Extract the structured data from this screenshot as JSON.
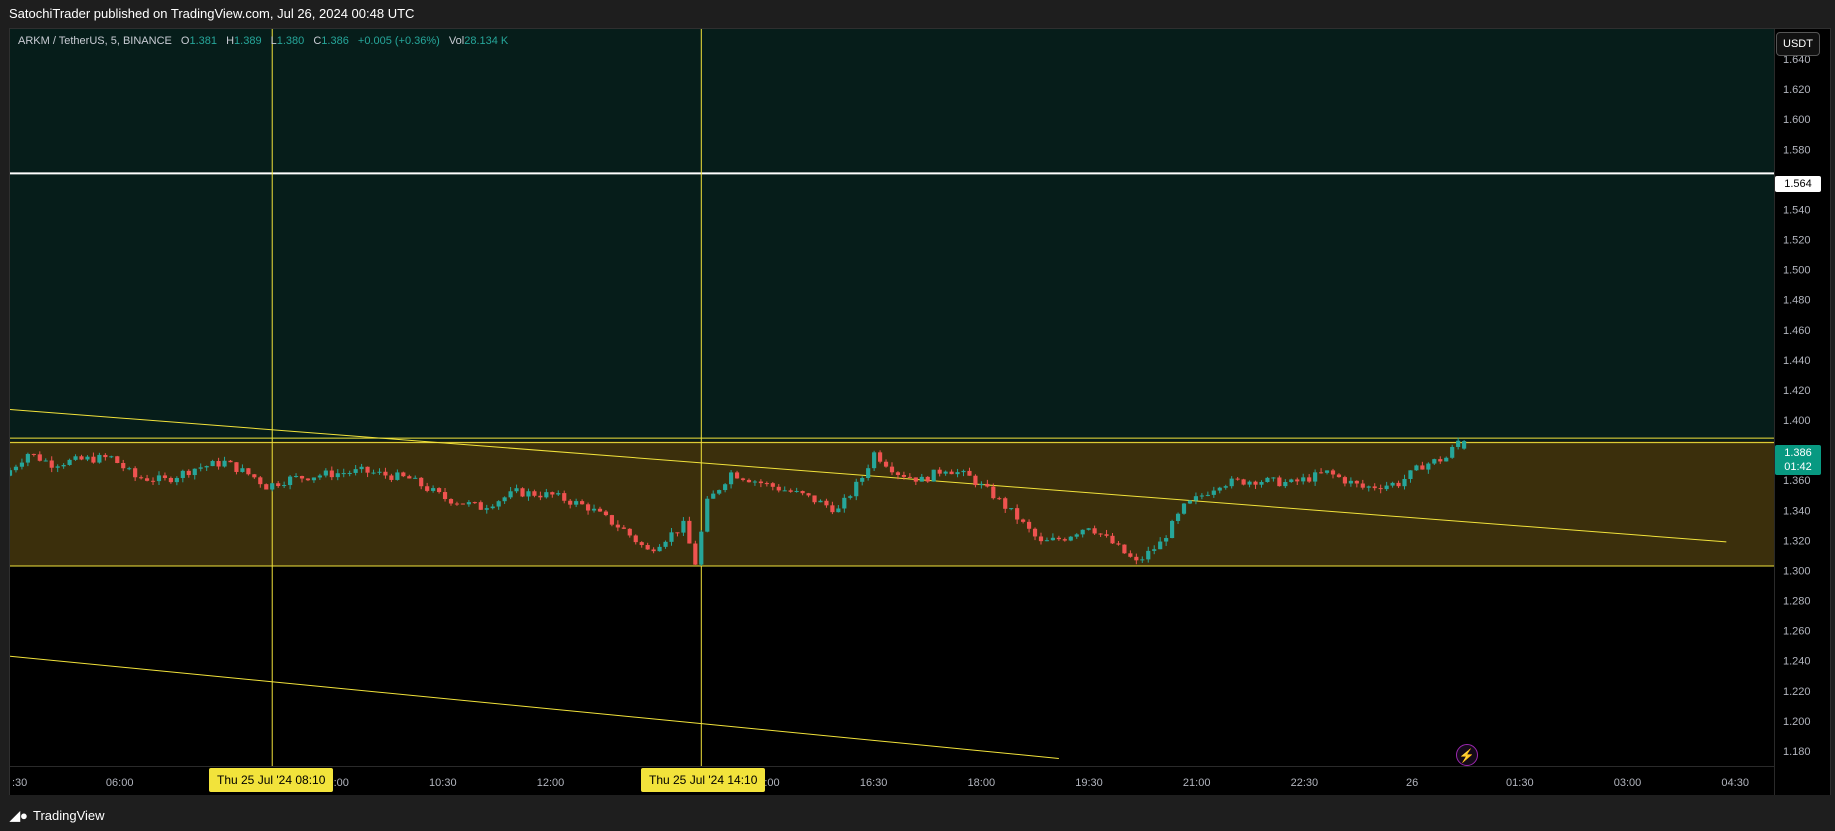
{
  "header": {
    "publisher_text": "SatochiTrader published on TradingView.com, Jul 26, 2024 00:48 UTC"
  },
  "legend": {
    "symbol": "ARKM / TetherUS, 5, BINANCE",
    "o_label": "O",
    "o_value": "1.381",
    "h_label": "H",
    "h_value": "1.389",
    "l_label": "L",
    "l_value": "1.380",
    "c_label": "C",
    "c_value": "1.386",
    "change": "+0.005 (+0.36%)",
    "vol_label": "Vol",
    "vol_value": "28.134 K"
  },
  "currency_button": "USDT",
  "price_tags": {
    "level": "1.564",
    "last_price": "1.386",
    "countdown": "01:42"
  },
  "time_tags": [
    {
      "label": "Thu 25 Jul '24   08:10"
    },
    {
      "label": "Thu 25 Jul '24   14:10"
    }
  ],
  "footer": {
    "brand": "TradingView",
    "logo_icon": "tradingview-logo-icon",
    "alert_icon": "lightning-icon"
  },
  "colors": {
    "up": "#26a69a",
    "down": "#ef5350",
    "zone_fill": "#3b2f0c",
    "upper_fill": "#061d1a",
    "yellow": "#f2e33b",
    "white_line": "#ffffff"
  },
  "chart_data": {
    "type": "candlestick",
    "title": "ARKM / TetherUS, 5, BINANCE",
    "y_axis": {
      "ylim": [
        1.17,
        1.66
      ],
      "ticks": [
        "1.640",
        "1.620",
        "1.600",
        "1.580",
        "1.560",
        "1.540",
        "1.520",
        "1.500",
        "1.480",
        "1.460",
        "1.440",
        "1.420",
        "1.400",
        "1.380",
        "1.360",
        "1.340",
        "1.320",
        "1.300",
        "1.280",
        "1.260",
        "1.240",
        "1.220",
        "1.200",
        "1.180"
      ]
    },
    "x_axis": {
      "tick_labels": [
        ":30",
        "06:00",
        "07:30",
        "09:00",
        "10:30",
        "12:00",
        "13:30",
        "15:00",
        "16:30",
        "18:00",
        "19:30",
        "21:00",
        "22:30",
        "26",
        "01:30",
        "03:00",
        "04:30"
      ],
      "range": [
        "Jul 25 04:30",
        "Jul 26 05:10"
      ]
    },
    "horizontal_levels": [
      {
        "price": 1.564,
        "color": "#ffffff"
      },
      {
        "price": 1.388,
        "color": "#f2e33b"
      },
      {
        "price": 1.385,
        "color": "#f2e33b"
      },
      {
        "price": 1.303,
        "color": "#f2e33b"
      }
    ],
    "zones": [
      {
        "from": 1.303,
        "to": 1.386,
        "color": "#3b2f0c"
      },
      {
        "from": 1.386,
        "to": 1.66,
        "color": "#061d1a"
      }
    ],
    "trendlines": [
      {
        "from": [
          "Jul 25 04:30",
          1.407
        ],
        "to": [
          "Jul 26 04:30",
          1.319
        ]
      },
      {
        "from": [
          "Jul 25 04:30",
          1.243
        ],
        "to": [
          "Jul 25 19:10",
          1.175
        ]
      }
    ],
    "vertical_lines": [
      "Jul 25 08:10",
      "Jul 25 14:10"
    ],
    "price_anchors": [
      [
        "Jul 25 04:30",
        1.363
      ],
      [
        "Jul 25 04:50",
        1.378
      ],
      [
        "Jul 25 05:10",
        1.371
      ],
      [
        "Jul 25 05:40",
        1.374
      ],
      [
        "Jul 25 06:00",
        1.375
      ],
      [
        "Jul 25 06:20",
        1.362
      ],
      [
        "Jul 25 06:45",
        1.36
      ],
      [
        "Jul 25 07:10",
        1.368
      ],
      [
        "Jul 25 07:35",
        1.372
      ],
      [
        "Jul 25 08:00",
        1.362
      ],
      [
        "Jul 25 08:10",
        1.356
      ],
      [
        "Jul 25 08:30",
        1.361
      ],
      [
        "Jul 25 09:00",
        1.364
      ],
      [
        "Jul 25 09:30",
        1.366
      ],
      [
        "Jul 25 10:10",
        1.361
      ],
      [
        "Jul 25 10:40",
        1.348
      ],
      [
        "Jul 25 11:10",
        1.342
      ],
      [
        "Jul 25 11:40",
        1.352
      ],
      [
        "Jul 25 12:10",
        1.35
      ],
      [
        "Jul 25 12:40",
        1.342
      ],
      [
        "Jul 25 13:10",
        1.327
      ],
      [
        "Jul 25 13:30",
        1.313
      ],
      [
        "Jul 25 14:00",
        1.33
      ],
      [
        "Jul 25 14:10",
        1.305
      ],
      [
        "Jul 25 14:20",
        1.345
      ],
      [
        "Jul 25 14:40",
        1.365
      ],
      [
        "Jul 25 15:10",
        1.357
      ],
      [
        "Jul 25 15:40",
        1.35
      ],
      [
        "Jul 25 16:10",
        1.34
      ],
      [
        "Jul 25 16:30",
        1.362
      ],
      [
        "Jul 25 16:40",
        1.378
      ],
      [
        "Jul 25 17:00",
        1.365
      ],
      [
        "Jul 25 17:20",
        1.36
      ],
      [
        "Jul 25 17:40",
        1.368
      ],
      [
        "Jul 25 18:00",
        1.362
      ],
      [
        "Jul 25 18:20",
        1.35
      ],
      [
        "Jul 25 18:40",
        1.335
      ],
      [
        "Jul 25 19:00",
        1.318
      ],
      [
        "Jul 25 19:20",
        1.322
      ],
      [
        "Jul 25 19:40",
        1.33
      ],
      [
        "Jul 25 20:00",
        1.318
      ],
      [
        "Jul 25 20:20",
        1.305
      ],
      [
        "Jul 25 20:40",
        1.318
      ],
      [
        "Jul 25 21:00",
        1.342
      ],
      [
        "Jul 25 21:30",
        1.358
      ],
      [
        "Jul 25 22:00",
        1.36
      ],
      [
        "Jul 25 22:30",
        1.358
      ],
      [
        "Jul 25 23:00",
        1.365
      ],
      [
        "Jul 25 23:30",
        1.355
      ],
      [
        "Jul 26 00:00",
        1.358
      ],
      [
        "Jul 26 00:20",
        1.37
      ],
      [
        "Jul 26 00:40",
        1.375
      ],
      [
        "Jul 26 00:50",
        1.386
      ]
    ],
    "last_candle": {
      "o": 1.381,
      "h": 1.389,
      "l": 1.38,
      "c": 1.386
    }
  }
}
